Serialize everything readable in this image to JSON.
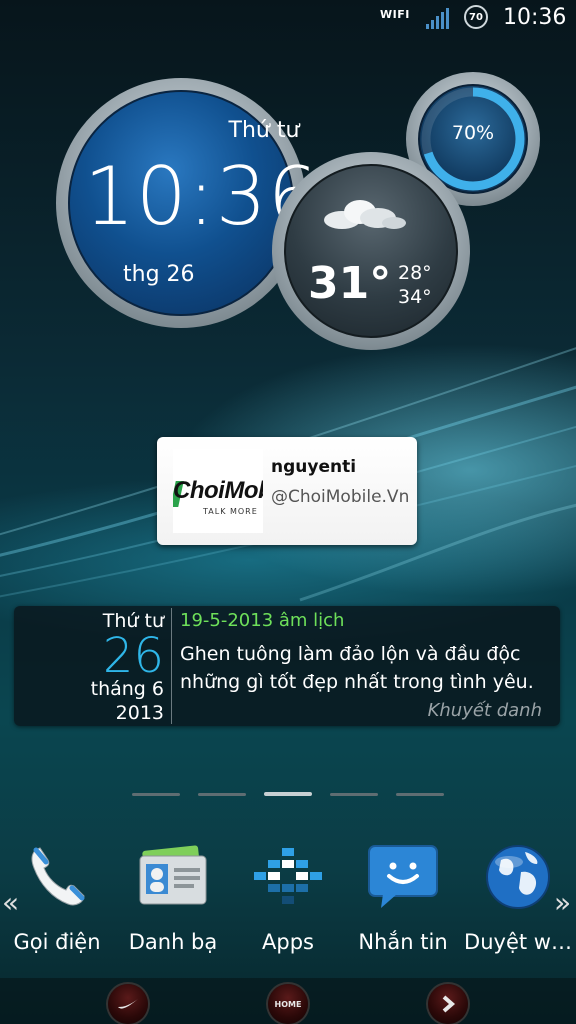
{
  "status_bar": {
    "wifi": "WIFI",
    "battery": "70",
    "time": "10:36"
  },
  "clock_widget": {
    "weekday": "Thứ tư",
    "time": "10:36",
    "date": "thg 26"
  },
  "weather_widget": {
    "temperature": "31°",
    "high": "28°",
    "low": "34°"
  },
  "progress_widget": {
    "value_text": "70%",
    "fraction": 0.7
  },
  "social_card": {
    "logo_text": "ChoiMobile",
    "logo_tagline": "TALK MORE",
    "name": "nguyenti",
    "handle": "@ChoiMobile.Vn"
  },
  "calendar_widget": {
    "weekday": "Thứ tư",
    "day": "26",
    "month": "tháng 6",
    "year": "2013",
    "lunar_date": "19-5-2013 âm lịch",
    "quote": "Ghen tuông làm đảo lộn và đầu độc những gì tốt đẹp nhất trong tình yêu.",
    "author": "Khuyết danh"
  },
  "page_indicator": {
    "count": 5,
    "active": 3
  },
  "dock": {
    "left_arrow": "«",
    "right_arrow": "»",
    "items": [
      {
        "label": "Gọi điện",
        "icon": "phone-icon"
      },
      {
        "label": "Danh bạ",
        "icon": "contacts-icon"
      },
      {
        "label": "Apps",
        "icon": "apps-grid-icon"
      },
      {
        "label": "Nhắn tin",
        "icon": "messaging-icon"
      },
      {
        "label": "Duyệt w…",
        "icon": "browser-globe-icon"
      }
    ]
  },
  "nav_bar": {
    "home_label": "HOME"
  }
}
